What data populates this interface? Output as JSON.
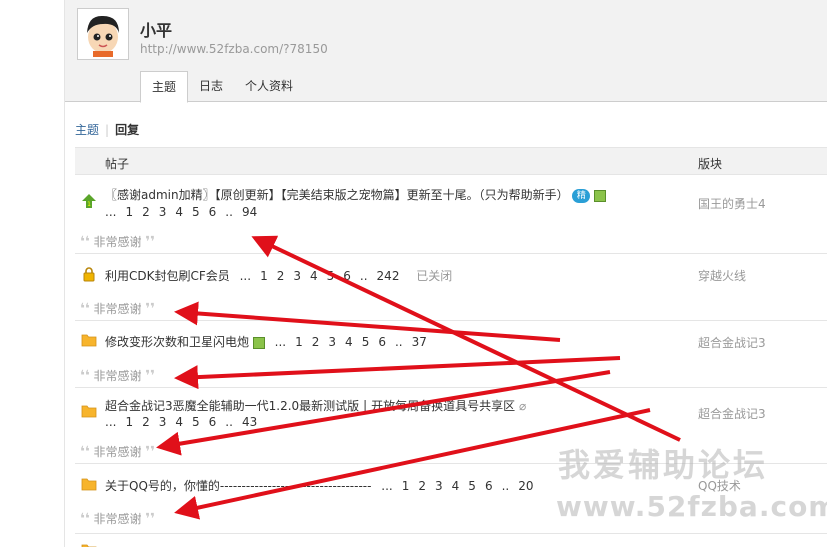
{
  "user": {
    "name": "小平",
    "link": "http://www.52fzba.com/?78150"
  },
  "tabs": [
    {
      "label": "主题",
      "active": true
    },
    {
      "label": "日志",
      "active": false
    },
    {
      "label": "个人资料",
      "active": false
    }
  ],
  "subnav": {
    "topics": "主题",
    "sep": "|",
    "replies": "回复"
  },
  "table": {
    "col_post": "帖子",
    "col_forum": "版块"
  },
  "rows": [
    {
      "icon": "up-arrow-icon",
      "title": "〖感谢admin加精〗【原创更新】【完美结束版之宠物篇】更新至十尾。（只为帮助新手）",
      "badge": "精",
      "pages": [
        "...",
        "1",
        "2",
        "3",
        "4",
        "5",
        "6",
        "..",
        "94"
      ],
      "forum": "国王的勇士4",
      "quote": "非常感谢"
    },
    {
      "icon": "lock-icon",
      "title": "利用CDK封包刷CF会员",
      "pages": [
        "...",
        "1",
        "2",
        "3",
        "4",
        "5",
        "6",
        "..",
        "242"
      ],
      "status": "已关闭",
      "forum": "穿越火线",
      "quote": "非常感谢"
    },
    {
      "icon": "folder-icon",
      "title": "修改变形次数和卫星闪电炮",
      "pages": [
        "...",
        "1",
        "2",
        "3",
        "4",
        "5",
        "6",
        "..",
        "37"
      ],
      "forum": "超合金战记3",
      "quote": "非常感谢"
    },
    {
      "icon": "folder-icon",
      "title": "超合金战记3恶魔全能辅助一代1.2.0最新测试版丨开放每周备换道具号共享区",
      "pages": [
        "...",
        "1",
        "2",
        "3",
        "4",
        "5",
        "6",
        "..",
        "43"
      ],
      "forum": "超合金战记3",
      "quote": "非常感谢"
    },
    {
      "icon": "folder-icon",
      "title": "关于QQ号的，你懂的-----------------------------------",
      "pages": [
        "...",
        "1",
        "2",
        "3",
        "4",
        "5",
        "6",
        "..",
        "20"
      ],
      "forum": "QQ技术",
      "quote": "非常感谢"
    }
  ],
  "watermark": {
    "line1": "我爱辅助论坛",
    "line2": "www.52fzba.com"
  },
  "colors": {
    "link": "#336699",
    "header_bg": "#f2f2f2",
    "arrow": "#e0101a",
    "forum_text": "#999999"
  }
}
